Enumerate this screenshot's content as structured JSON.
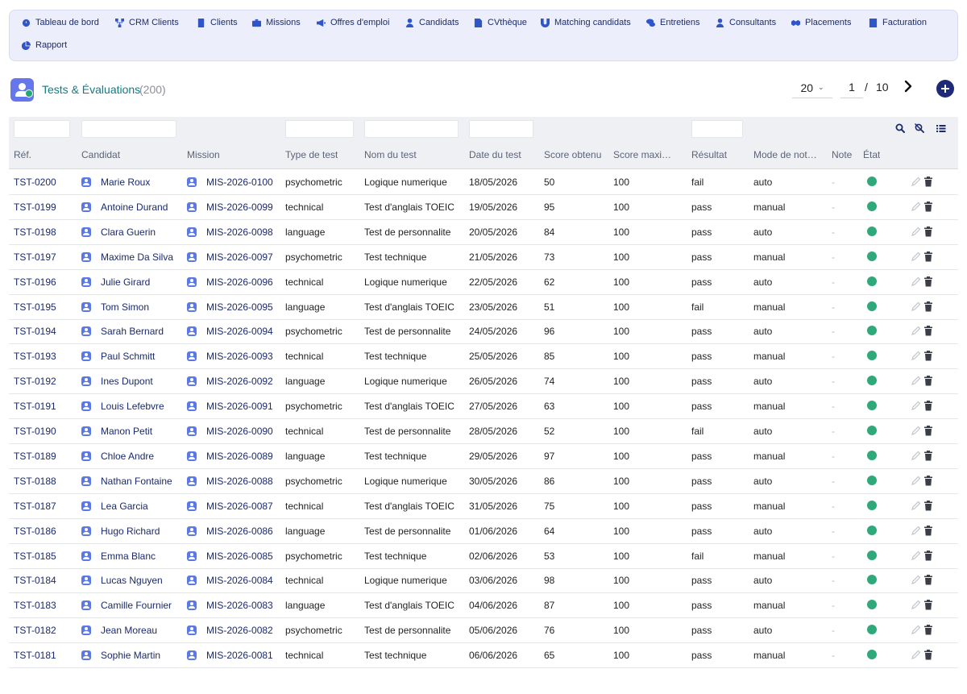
{
  "nav": {
    "items": [
      {
        "label": "Tableau de bord",
        "icon": "dashboard-icon"
      },
      {
        "label": "CRM Clients",
        "icon": "network-icon"
      },
      {
        "label": "Clients",
        "icon": "building-icon"
      },
      {
        "label": "Missions",
        "icon": "briefcase-icon"
      },
      {
        "label": "Offres d'emploi",
        "icon": "megaphone-icon"
      },
      {
        "label": "Candidats",
        "icon": "user-icon"
      },
      {
        "label": "CVthèque",
        "icon": "file-icon"
      },
      {
        "label": "Matching candidats",
        "icon": "magnet-icon"
      },
      {
        "label": "Entretiens",
        "icon": "comments-icon"
      },
      {
        "label": "Consultants",
        "icon": "user-tie-icon"
      },
      {
        "label": "Placements",
        "icon": "handshake-icon"
      },
      {
        "label": "Facturation",
        "icon": "invoice-icon"
      },
      {
        "label": "Rapport",
        "icon": "pie-chart-icon"
      }
    ]
  },
  "header": {
    "title": "Tests & Évaluations",
    "count": "(200)"
  },
  "pagination": {
    "page_size": "20",
    "current_page": "1",
    "separator": "/",
    "total_pages": "10"
  },
  "table": {
    "columns": [
      "Réf.",
      "Candidat",
      "Mission",
      "Type de test",
      "Nom du test",
      "Date du test",
      "Score obtenu",
      "Score maxi…",
      "Résultat",
      "Mode de not…",
      "Note",
      "État"
    ],
    "rows": [
      {
        "ref": "TST-0200",
        "candidate": "Marie Roux",
        "mission": "MIS-2026-0100",
        "type": "psychometric",
        "test": "Logique numerique",
        "date": "18/05/2026",
        "score": "50",
        "max": "100",
        "result": "fail",
        "mode": "auto",
        "note": "-"
      },
      {
        "ref": "TST-0199",
        "candidate": "Antoine Durand",
        "mission": "MIS-2026-0099",
        "type": "technical",
        "test": "Test d'anglais TOEIC",
        "date": "19/05/2026",
        "score": "95",
        "max": "100",
        "result": "pass",
        "mode": "manual",
        "note": "-"
      },
      {
        "ref": "TST-0198",
        "candidate": "Clara Guerin",
        "mission": "MIS-2026-0098",
        "type": "language",
        "test": "Test de personnalite",
        "date": "20/05/2026",
        "score": "84",
        "max": "100",
        "result": "pass",
        "mode": "auto",
        "note": "-"
      },
      {
        "ref": "TST-0197",
        "candidate": "Maxime Da Silva",
        "mission": "MIS-2026-0097",
        "type": "psychometric",
        "test": "Test technique",
        "date": "21/05/2026",
        "score": "73",
        "max": "100",
        "result": "pass",
        "mode": "manual",
        "note": "-"
      },
      {
        "ref": "TST-0196",
        "candidate": "Julie Girard",
        "mission": "MIS-2026-0096",
        "type": "technical",
        "test": "Logique numerique",
        "date": "22/05/2026",
        "score": "62",
        "max": "100",
        "result": "pass",
        "mode": "auto",
        "note": "-"
      },
      {
        "ref": "TST-0195",
        "candidate": "Tom Simon",
        "mission": "MIS-2026-0095",
        "type": "language",
        "test": "Test d'anglais TOEIC",
        "date": "23/05/2026",
        "score": "51",
        "max": "100",
        "result": "fail",
        "mode": "manual",
        "note": "-"
      },
      {
        "ref": "TST-0194",
        "candidate": "Sarah Bernard",
        "mission": "MIS-2026-0094",
        "type": "psychometric",
        "test": "Test de personnalite",
        "date": "24/05/2026",
        "score": "96",
        "max": "100",
        "result": "pass",
        "mode": "auto",
        "note": "-"
      },
      {
        "ref": "TST-0193",
        "candidate": "Paul Schmitt",
        "mission": "MIS-2026-0093",
        "type": "technical",
        "test": "Test technique",
        "date": "25/05/2026",
        "score": "85",
        "max": "100",
        "result": "pass",
        "mode": "manual",
        "note": "-"
      },
      {
        "ref": "TST-0192",
        "candidate": "Ines Dupont",
        "mission": "MIS-2026-0092",
        "type": "language",
        "test": "Logique numerique",
        "date": "26/05/2026",
        "score": "74",
        "max": "100",
        "result": "pass",
        "mode": "auto",
        "note": "-"
      },
      {
        "ref": "TST-0191",
        "candidate": "Louis Lefebvre",
        "mission": "MIS-2026-0091",
        "type": "psychometric",
        "test": "Test d'anglais TOEIC",
        "date": "27/05/2026",
        "score": "63",
        "max": "100",
        "result": "pass",
        "mode": "manual",
        "note": "-"
      },
      {
        "ref": "TST-0190",
        "candidate": "Manon Petit",
        "mission": "MIS-2026-0090",
        "type": "technical",
        "test": "Test de personnalite",
        "date": "28/05/2026",
        "score": "52",
        "max": "100",
        "result": "fail",
        "mode": "auto",
        "note": "-"
      },
      {
        "ref": "TST-0189",
        "candidate": "Chloe Andre",
        "mission": "MIS-2026-0089",
        "type": "language",
        "test": "Test technique",
        "date": "29/05/2026",
        "score": "97",
        "max": "100",
        "result": "pass",
        "mode": "manual",
        "note": "-"
      },
      {
        "ref": "TST-0188",
        "candidate": "Nathan Fontaine",
        "mission": "MIS-2026-0088",
        "type": "psychometric",
        "test": "Logique numerique",
        "date": "30/05/2026",
        "score": "86",
        "max": "100",
        "result": "pass",
        "mode": "auto",
        "note": "-"
      },
      {
        "ref": "TST-0187",
        "candidate": "Lea Garcia",
        "mission": "MIS-2026-0087",
        "type": "technical",
        "test": "Test d'anglais TOEIC",
        "date": "31/05/2026",
        "score": "75",
        "max": "100",
        "result": "pass",
        "mode": "manual",
        "note": "-"
      },
      {
        "ref": "TST-0186",
        "candidate": "Hugo Richard",
        "mission": "MIS-2026-0086",
        "type": "language",
        "test": "Test de personnalite",
        "date": "01/06/2026",
        "score": "64",
        "max": "100",
        "result": "pass",
        "mode": "auto",
        "note": "-"
      },
      {
        "ref": "TST-0185",
        "candidate": "Emma Blanc",
        "mission": "MIS-2026-0085",
        "type": "psychometric",
        "test": "Test technique",
        "date": "02/06/2026",
        "score": "53",
        "max": "100",
        "result": "fail",
        "mode": "manual",
        "note": "-"
      },
      {
        "ref": "TST-0184",
        "candidate": "Lucas Nguyen",
        "mission": "MIS-2026-0084",
        "type": "technical",
        "test": "Logique numerique",
        "date": "03/06/2026",
        "score": "98",
        "max": "100",
        "result": "pass",
        "mode": "auto",
        "note": "-"
      },
      {
        "ref": "TST-0183",
        "candidate": "Camille Fournier",
        "mission": "MIS-2026-0083",
        "type": "language",
        "test": "Test d'anglais TOEIC",
        "date": "04/06/2026",
        "score": "87",
        "max": "100",
        "result": "pass",
        "mode": "manual",
        "note": "-"
      },
      {
        "ref": "TST-0182",
        "candidate": "Jean Moreau",
        "mission": "MIS-2026-0082",
        "type": "psychometric",
        "test": "Test de personnalite",
        "date": "05/06/2026",
        "score": "76",
        "max": "100",
        "result": "pass",
        "mode": "auto",
        "note": "-"
      },
      {
        "ref": "TST-0181",
        "candidate": "Sophie Martin",
        "mission": "MIS-2026-0081",
        "type": "technical",
        "test": "Test technique",
        "date": "06/06/2026",
        "score": "65",
        "max": "100",
        "result": "pass",
        "mode": "manual",
        "note": "-"
      }
    ]
  },
  "colors": {
    "accent": "#117b86",
    "nav_bg": "#eceefb",
    "primary_dark": "#1e2a78",
    "status_active": "#2fa87a",
    "link": "#1a2a6c"
  }
}
